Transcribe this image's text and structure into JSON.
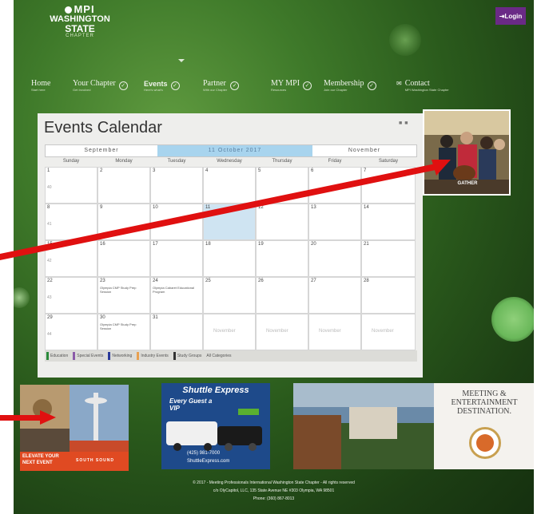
{
  "logo": {
    "brand": "MPI",
    "state_line1": "WASHINGTON",
    "state_line2": "STATE",
    "chapter": "CHAPTER"
  },
  "login": {
    "label": "Login"
  },
  "nav": [
    {
      "label": "Home",
      "sub": "Start here",
      "active": false,
      "check": false
    },
    {
      "label": "Your Chapter",
      "sub": "Get Involved",
      "active": false,
      "check": true
    },
    {
      "label": "Events",
      "sub": "Here's what's",
      "active": true,
      "check": true
    },
    {
      "label": "Partner",
      "sub": "With our Chapter",
      "active": false,
      "check": true
    },
    {
      "label": "MY MPI",
      "sub": "Resources",
      "active": false,
      "check": true
    },
    {
      "label": "Membership",
      "sub": "Join our Chapter",
      "active": false,
      "check": true
    },
    {
      "label": "Contact",
      "sub": "MPI Washington State Chapter",
      "active": false,
      "check": false
    }
  ],
  "calendar": {
    "title": "Events Calendar",
    "months": {
      "prev": "September",
      "current": "11 October 2017",
      "next": "November"
    },
    "days": [
      "Sunday",
      "Monday",
      "Tuesday",
      "Wednesday",
      "Thursday",
      "Friday",
      "Saturday"
    ],
    "weeks": [
      {
        "week": "40",
        "days": [
          "1",
          "2",
          "3",
          "4",
          "5",
          "6",
          "7"
        ]
      },
      {
        "week": "41",
        "days": [
          "8",
          "9",
          "10",
          "11",
          "12",
          "13",
          "14"
        ]
      },
      {
        "week": "42",
        "days": [
          "15",
          "16",
          "17",
          "18",
          "19",
          "20",
          "21"
        ]
      },
      {
        "week": "43",
        "days": [
          "22",
          "23",
          "24",
          "25",
          "26",
          "27",
          "28"
        ]
      },
      {
        "week": "44",
        "days": [
          "29",
          "30",
          "31",
          "November",
          "November",
          "November",
          "November"
        ]
      }
    ],
    "events": {
      "w3d1": "Olympia CMP Study Prep Session",
      "w3d2": "Olympia Cabaret Educational Program",
      "w4d1": "Olympia CMP Study Prep Session"
    },
    "legend": [
      "Education",
      "Special Events",
      "Networking",
      "Industry Events",
      "Study Groups",
      "All Categories"
    ],
    "legend_colors": [
      "#2a8a3a",
      "#8a5aa8",
      "#2a3a9a",
      "#e8a050",
      "#333333",
      "#dcdcd8"
    ]
  },
  "ads": {
    "right_top_caption": "GATHER",
    "left_caption": "ELEVATE YOUR NEXT EVENT",
    "left_brand": "SOUTH SOUND",
    "mid_brand": "Shuttle Express",
    "mid_tagline": "Every Guest a VIP",
    "mid_phone": "(425) 981-7000",
    "mid_site": "ShuttleExpress.com",
    "right_text_1": "MEETING &",
    "right_text_2": "ENTERTAINMENT",
    "right_text_3": "DESTINATION."
  },
  "footer": {
    "line1": "© 2017 - Meeting Professionals International Washington State Chapter - All rights reserved",
    "line2": "c/o OlyCapitol, LLC, 135 State Avenue NE #303 Olympia, WA 98501",
    "line3": "Phone: (360) 867-8013"
  },
  "colors": {
    "bg_dark": "#1d3f14",
    "bg_light": "#5f9a3f",
    "login_purple": "#6a2a86",
    "today_blue": "#a8d4ee",
    "arrow_red": "#e01010"
  }
}
